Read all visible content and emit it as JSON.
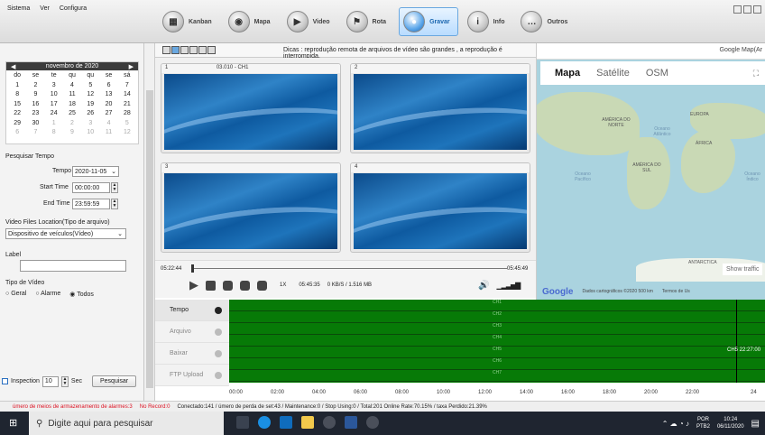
{
  "menu": [
    "Sistema",
    "Ver",
    "Configura"
  ],
  "toolbar": [
    {
      "label": "Kanban",
      "icon": "kanban-icon"
    },
    {
      "label": "Mapa",
      "icon": "map-icon"
    },
    {
      "label": "Video",
      "icon": "video-icon"
    },
    {
      "label": "Rota",
      "icon": "route-icon"
    },
    {
      "label": "Gravar",
      "icon": "record-icon",
      "active": true
    },
    {
      "label": "Info",
      "icon": "info-icon"
    },
    {
      "label": "Outros",
      "icon": "others-icon"
    }
  ],
  "calendar": {
    "month": "novembro de 2020",
    "weekdays": [
      "do",
      "se",
      "te",
      "qu",
      "qu",
      "se",
      "sá"
    ],
    "days": [
      [
        "1",
        "2",
        "3",
        "4",
        "5",
        "6",
        "7"
      ],
      [
        "8",
        "9",
        "10",
        "11",
        "12",
        "13",
        "14"
      ],
      [
        "15",
        "16",
        "17",
        "18",
        "19",
        "20",
        "21"
      ],
      [
        "22",
        "23",
        "24",
        "25",
        "26",
        "27",
        "28"
      ],
      [
        "29",
        "30",
        "1",
        "2",
        "3",
        "4",
        "5"
      ],
      [
        "6",
        "7",
        "8",
        "9",
        "10",
        "11",
        "12"
      ]
    ]
  },
  "search": {
    "section": "Pesquisar Tempo",
    "tempo_label": "Tempo",
    "tempo_value": "2020-11-05",
    "start_label": "Start Time",
    "start_value": "00:00:00",
    "end_label": "End Time",
    "end_value": "23:59:59",
    "location_label": "Video Files Location(Tipo de arquivo)",
    "location_value": "Dispositivo de veículos(Vídeo)",
    "label_label": "Label",
    "tipo_label": "Tipo de Vídeo",
    "radios": [
      "Geral",
      "Alarme",
      "Todos"
    ],
    "inspection_label": "Inspection",
    "inspection_value": "10",
    "sec_label": "Sec",
    "button": "Pesquisar"
  },
  "video": {
    "tip": "Dicas : reprodução remota de arquivos de vídeo são grandes , a reprodução é interrompida.",
    "tiles": [
      {
        "num": "1",
        "title": "03.010 - CH1"
      },
      {
        "num": "2",
        "title": ""
      },
      {
        "num": "3",
        "title": ""
      },
      {
        "num": "4",
        "title": ""
      }
    ]
  },
  "playback": {
    "start": "05:22:44",
    "end": "05:45:49",
    "speed": "1X",
    "current": "05:45:35",
    "rate": "0 KB/S / 1.516 MB"
  },
  "map": {
    "title": "Google Map(Ar",
    "tabs": [
      "Mapa",
      "Satélite",
      "OSM"
    ],
    "labels": [
      "AMÉRICA DO NORTE",
      "EUROPA",
      "ÁFRICA",
      "Oceano Atlântico",
      "AMÉRICA DO SUL",
      "Oceano Pacífico",
      "Oceano Índico",
      "ANTARCTICA"
    ],
    "show_traffic": "Show traffic",
    "google": "Google",
    "footer": "Dados cartográficos ©2020   500 km",
    "terms": "Termos de Us"
  },
  "timeline": {
    "buttons": [
      "Tempo",
      "Arquivo",
      "Baixar",
      "FTP Upload"
    ],
    "channels": [
      "CH1",
      "CH2",
      "CH3",
      "CH4",
      "CH5",
      "CH6",
      "CH7"
    ],
    "marker": "CH5 22:27:00",
    "ticks": [
      "00:00",
      "02:00",
      "04:00",
      "06:00",
      "08:00",
      "10:00",
      "12:00",
      "14:00",
      "16:00",
      "18:00",
      "20:00",
      "22:00",
      "24"
    ]
  },
  "status": {
    "alarm": "úmero de meios de armazenamento de alarmes:3",
    "record": "No Record:0",
    "info": "Conectado:141 / úmero de perda de set:43 / Maintenance:0 / Stop Using:0 / Total:201   Online Rate:70.15% / taxa Perdido:21.39%"
  },
  "taskbar": {
    "search": "Digite aqui para pesquisar",
    "lang": "POR",
    "kb": "PTB2",
    "time": "10:24",
    "date": "06/11/2020"
  }
}
